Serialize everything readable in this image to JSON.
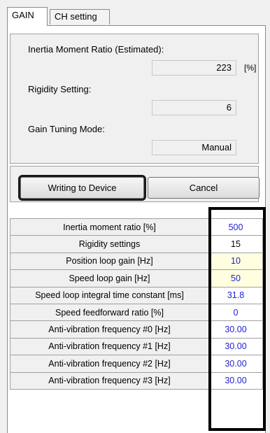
{
  "tabs": [
    {
      "label": "GAIN",
      "active": true
    },
    {
      "label": "CH setting",
      "active": false
    }
  ],
  "estimated": {
    "inertia_label": "Inertia Moment Ratio (Estimated):",
    "inertia_value": "223",
    "inertia_unit": "[%]",
    "rigidity_label": "Rigidity Setting:",
    "rigidity_value": "6",
    "mode_label": "Gain Tuning Mode:",
    "mode_value": "Manual"
  },
  "buttons": {
    "write_label": "Writing to Device",
    "cancel_label": "Cancel"
  },
  "parameters": [
    {
      "name": "Inertia moment ratio [%]",
      "value": "500",
      "color": "#1f1fd0",
      "highlight": false
    },
    {
      "name": "Rigidity settings",
      "value": "15",
      "color": "#000000",
      "highlight": false
    },
    {
      "name": "Position loop gain [Hz]",
      "value": "10",
      "color": "#1f1fd0",
      "highlight": true
    },
    {
      "name": "Speed loop gain [Hz]",
      "value": "50",
      "color": "#1f1fd0",
      "highlight": true
    },
    {
      "name": "Speed loop integral time constant [ms]",
      "value": "31.8",
      "color": "#1f1fd0",
      "highlight": false
    },
    {
      "name": "Speed feedforward ratio [%]",
      "value": "0",
      "color": "#1f1fd0",
      "highlight": false
    },
    {
      "name": "Anti-vibration frequency #0 [Hz]",
      "value": "30.00",
      "color": "#1f1fd0",
      "highlight": false
    },
    {
      "name": "Anti-vibration frequency #1 [Hz]",
      "value": "30.00",
      "color": "#1f1fd0",
      "highlight": false
    },
    {
      "name": "Anti-vibration frequency #2 [Hz]",
      "value": "30.00",
      "color": "#1f1fd0",
      "highlight": false
    },
    {
      "name": "Anti-vibration frequency #3 [Hz]",
      "value": "30.00",
      "color": "#1f1fd0",
      "highlight": false
    }
  ]
}
